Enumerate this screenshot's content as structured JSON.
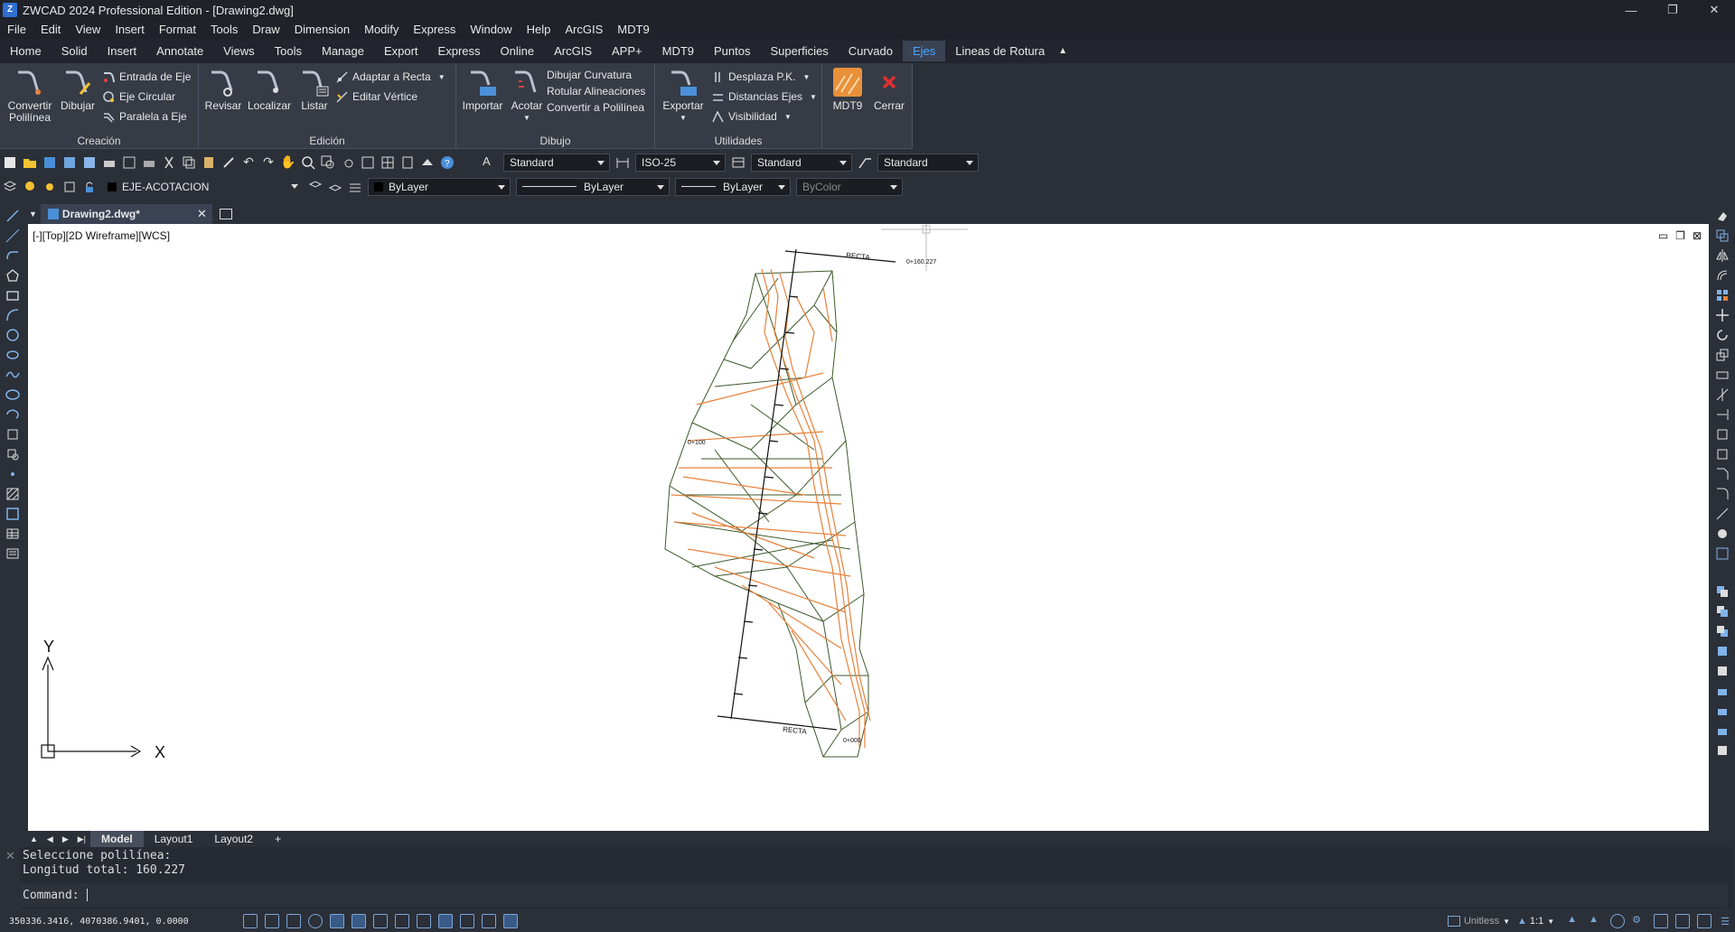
{
  "window": {
    "title": "ZWCAD 2024 Professional Edition - [Drawing2.dwg]",
    "app_icon": "zwcad-logo-icon",
    "controls": [
      "—",
      "❐",
      "✕"
    ]
  },
  "menu": [
    "File",
    "Edit",
    "View",
    "Insert",
    "Format",
    "Tools",
    "Draw",
    "Dimension",
    "Modify",
    "Express",
    "Window",
    "Help",
    "ArcGIS",
    "MDT9"
  ],
  "ribbon_tabs": [
    "Home",
    "Solid",
    "Insert",
    "Annotate",
    "Views",
    "Tools",
    "Manage",
    "Export",
    "Express",
    "Online",
    "ArcGIS",
    "APP+",
    "MDT9",
    "Puntos",
    "Superficies",
    "Curvado",
    "Ejes",
    "Lineas de Rotura"
  ],
  "active_tab": "Ejes",
  "ribbon": {
    "creacion": {
      "title": "Creación",
      "big": [
        "Convertir Polilínea",
        "Dibujar"
      ],
      "small": [
        "Entrada de Eje",
        "Eje Circular",
        "Paralela a Eje"
      ]
    },
    "edicion": {
      "title": "Edición",
      "big": [
        "Revisar",
        "Localizar",
        "Listar"
      ],
      "small": [
        "Adaptar a Recta",
        "Editar Vértice"
      ]
    },
    "dibujo": {
      "title": "Dibujo",
      "big": [
        "Importar",
        "Acotar"
      ],
      "small": [
        "Dibujar Curvatura",
        "Rotular Alineaciones",
        "Convertir a Polilínea"
      ]
    },
    "utilidades": {
      "title": "Utilidades",
      "big": [
        "Exportar"
      ],
      "small": [
        "Desplaza P.K.",
        "Distancias Ejes",
        "Visibilidad"
      ]
    },
    "mdt": {
      "big": [
        "MDT9",
        "Cerrar"
      ]
    }
  },
  "toolbar1": {
    "text_style": "Standard",
    "dim_style": "ISO-25",
    "table_style": "Standard",
    "mleader_style": "Standard"
  },
  "toolbar2": {
    "layer": "EJE-ACOTACION",
    "color": "ByLayer",
    "linetype": "ByLayer",
    "lineweight": "ByLayer",
    "plotstyle": "ByColor"
  },
  "document_tab": "Drawing2.dwg*",
  "viewport_label": "[-][Top][2D Wireframe][WCS]",
  "drawing": {
    "labels": [
      "RECTA",
      "0+160.227",
      "0+100",
      "RECTA",
      "0+000"
    ],
    "axis_x": "X",
    "axis_y": "Y"
  },
  "layout_tabs": [
    "Model",
    "Layout1",
    "Layout2",
    "+"
  ],
  "command_history": [
    "Seleccione polilínea:",
    "Longitud total: 160.227"
  ],
  "command_prompt": "Command:",
  "coordinates": "350336.3416, 4070386.9401, 0.0000",
  "status": {
    "units": "Unitless",
    "scale": "1:1"
  },
  "colors": {
    "accent": "#4aa3ff",
    "contour_orange": "#e8813a",
    "tin_green": "#3d5a2a"
  }
}
